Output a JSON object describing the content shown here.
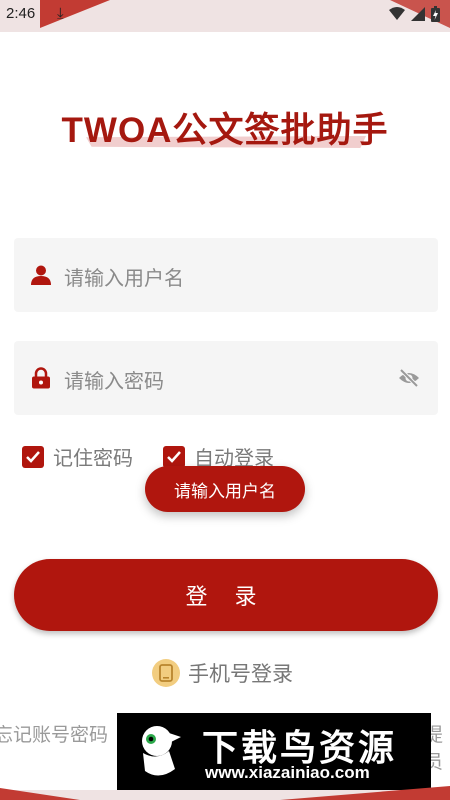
{
  "status_bar": {
    "time": "2:46",
    "icons": [
      "download-icon",
      "wifi-icon",
      "signal-icon",
      "battery-icon"
    ]
  },
  "app": {
    "title": "TWOA公文签批助手"
  },
  "form": {
    "username_placeholder": "请输入用户名",
    "password_placeholder": "请输入密码",
    "remember_password_label": "记住密码",
    "auto_login_label": "自动登录",
    "remember_password_checked": true,
    "auto_login_checked": true
  },
  "toast": {
    "message": "请输入用户名"
  },
  "actions": {
    "login_label": "登 录",
    "phone_login_label": "手机号登录",
    "forgot_left": "忘记账号密码",
    "forgot_right": "提员"
  },
  "watermark": {
    "title": "下载鸟资源",
    "url": "www.xiazainiao.com"
  },
  "colors": {
    "primary": "#b0160e",
    "title": "#a5180f",
    "field_bg": "#f5f5f5",
    "placeholder": "#8a8a8a",
    "phone_icon_bg": "#f2cd80"
  }
}
